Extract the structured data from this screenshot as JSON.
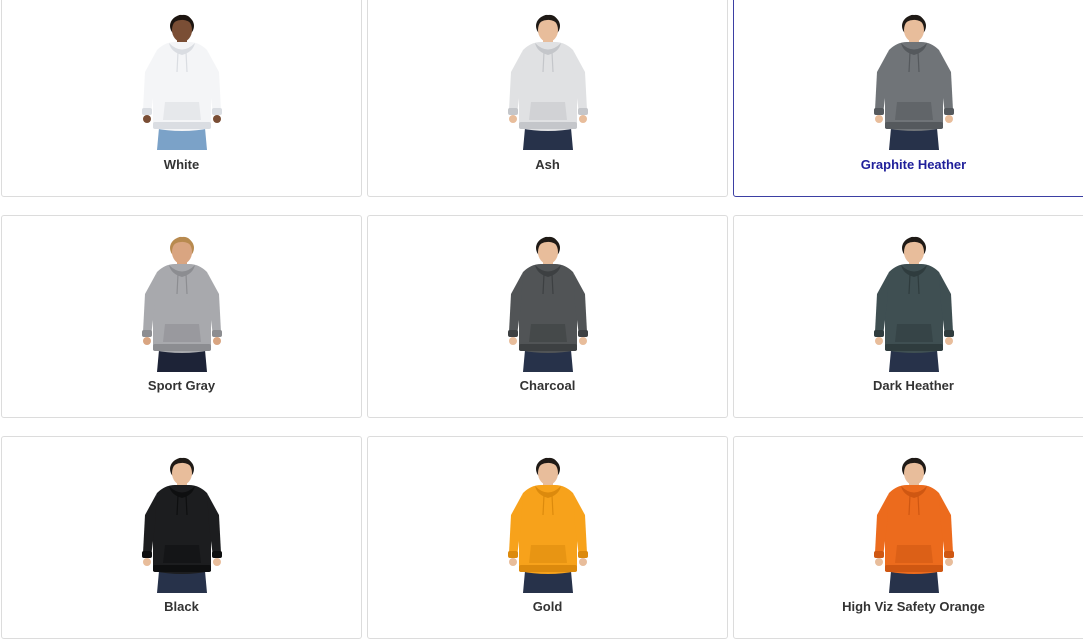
{
  "swatches": [
    {
      "label": "White",
      "body": "#f4f5f7",
      "shade": "#dadde2",
      "skin": "#7a4e35",
      "hair": "#1d1510",
      "pants": "#7ba2c8",
      "selected": false
    },
    {
      "label": "Ash",
      "body": "#e0e1e3",
      "shade": "#c4c6ca",
      "skin": "#e8bd9b",
      "hair": "#1f1a16",
      "pants": "#27324a",
      "selected": false
    },
    {
      "label": "Graphite Heather",
      "body": "#707478",
      "shade": "#55595d",
      "skin": "#e8bd9b",
      "hair": "#1f1a16",
      "pants": "#27324a",
      "selected": true
    },
    {
      "label": "Sport Gray",
      "body": "#a8a9ad",
      "shade": "#8c8d91",
      "skin": "#d9a581",
      "hair": "#b88a4f",
      "pants": "#1d2337",
      "selected": false
    },
    {
      "label": "Charcoal",
      "body": "#515456",
      "shade": "#3d4042",
      "skin": "#e8bd9b",
      "hair": "#1f1a16",
      "pants": "#27324a",
      "selected": false
    },
    {
      "label": "Dark Heather",
      "body": "#3f4f52",
      "shade": "#2f3c3e",
      "skin": "#e8bd9b",
      "hair": "#1f1a16",
      "pants": "#27324a",
      "selected": false
    },
    {
      "label": "Black",
      "body": "#1c1d1f",
      "shade": "#0e0f10",
      "skin": "#e8bd9b",
      "hair": "#1f1a16",
      "pants": "#27324a",
      "selected": false
    },
    {
      "label": "Gold",
      "body": "#f7a21b",
      "shade": "#dc8a0d",
      "skin": "#e8bd9b",
      "hair": "#1f1a16",
      "pants": "#27324a",
      "selected": false
    },
    {
      "label": "High Viz Safety Orange",
      "body": "#ec6b1d",
      "shade": "#cf5712",
      "skin": "#e8bd9b",
      "hair": "#1f1a16",
      "pants": "#27324a",
      "selected": false
    }
  ]
}
